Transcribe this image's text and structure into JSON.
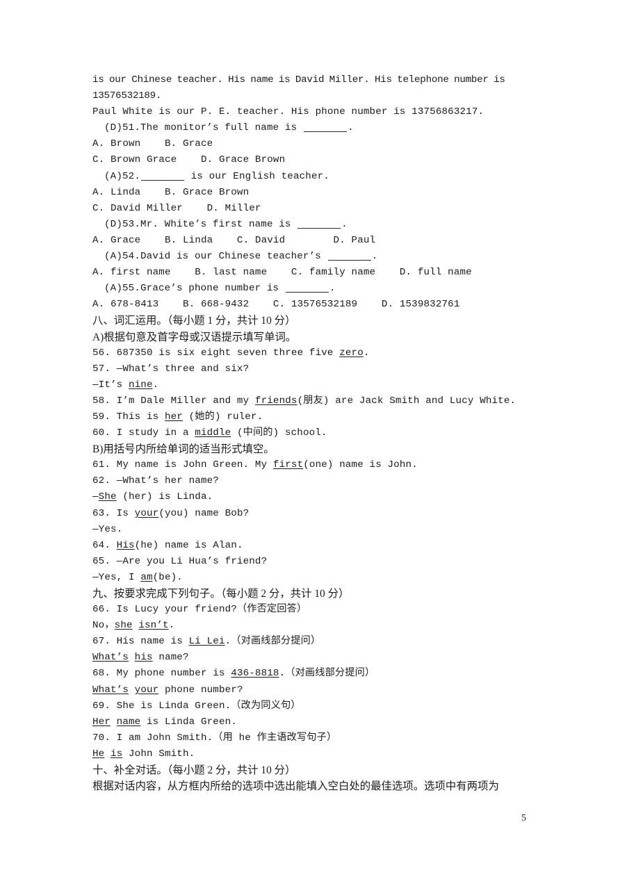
{
  "document": {
    "page_number": "5",
    "lines": [
      {
        "id": "passage-line-1",
        "kind": "en-justified",
        "text": "is our Chinese teacher. His name is David Miller. His telephone number is 13576532189."
      },
      {
        "id": "passage-line-2",
        "kind": "en",
        "text": "Paul White is our P. E. teacher. His phone number is 13756863217."
      },
      {
        "id": "q51-stem",
        "kind": "en-indent-blank",
        "answer": "(D)",
        "number": "51.",
        "text_before": "The monitor’s full name is ",
        "text_after": "."
      },
      {
        "id": "q51-options-1",
        "kind": "en",
        "text": "A. Brown    B. Grace"
      },
      {
        "id": "q51-options-2",
        "kind": "en",
        "text": "C. Brown Grace    D. Grace Brown"
      },
      {
        "id": "q52-stem",
        "kind": "en-indent-blank-lead",
        "answer": "(A)",
        "number": "52.",
        "text_before": "",
        "text_after": " is our English teacher."
      },
      {
        "id": "q52-options-1",
        "kind": "en",
        "text": "A. Linda    B. Grace Brown"
      },
      {
        "id": "q52-options-2",
        "kind": "en",
        "text": "C. David Miller    D. Miller"
      },
      {
        "id": "q53-stem",
        "kind": "en-indent-blank",
        "answer": "(D)",
        "number": "53.",
        "text_before": "Mr. White’s first name is ",
        "text_after": "."
      },
      {
        "id": "q53-options",
        "kind": "en",
        "text": "A. Grace    B. Linda    C. David        D. Paul"
      },
      {
        "id": "q54-stem",
        "kind": "en-indent-blank",
        "answer": "(A)",
        "number": "54.",
        "text_before": "David is our Chinese teacher’s ",
        "text_after": "."
      },
      {
        "id": "q54-options",
        "kind": "en",
        "text": "A. first name    B. last name    C. family name    D. full name"
      },
      {
        "id": "q55-stem",
        "kind": "en-indent-blank",
        "answer": "(A)",
        "number": "55.",
        "text_before": "Grace’s phone number is ",
        "text_after": "."
      },
      {
        "id": "q55-options",
        "kind": "en",
        "text": "A. 678-8413    B. 668-9432    C. 13576532189    D. 1539832761"
      },
      {
        "id": "section-8-heading",
        "kind": "cn",
        "text": "八、词汇运用。（每小题 1 分，共计 10 分）"
      },
      {
        "id": "section-8a-instruction",
        "kind": "cn",
        "text": "A)根据句意及首字母或汉语提示填写单词。"
      },
      {
        "id": "q56",
        "kind": "en-u",
        "parts": [
          {
            "t": "56. 687350 is six eight seven three five "
          },
          {
            "t": "zero",
            "u": true
          },
          {
            "t": "."
          }
        ]
      },
      {
        "id": "q57-line1",
        "kind": "en",
        "text": "57. —What’s three and six?"
      },
      {
        "id": "q57-line2",
        "kind": "en-u",
        "parts": [
          {
            "t": "—It’s "
          },
          {
            "t": "nine",
            "u": true
          },
          {
            "t": "."
          }
        ]
      },
      {
        "id": "q58",
        "kind": "en-u",
        "parts": [
          {
            "t": "58. I’m Dale Miller and my "
          },
          {
            "t": "friends",
            "u": true
          },
          {
            "t": "(朋友) are Jack Smith and Lucy White."
          }
        ]
      },
      {
        "id": "q59",
        "kind": "en-u",
        "parts": [
          {
            "t": "59. This is "
          },
          {
            "t": "her",
            "u": true
          },
          {
            "t": " (她的) ruler."
          }
        ]
      },
      {
        "id": "q60",
        "kind": "en-u",
        "parts": [
          {
            "t": "60. I study in a "
          },
          {
            "t": "middle",
            "u": true
          },
          {
            "t": " (中间的) school."
          }
        ]
      },
      {
        "id": "section-8b-instruction",
        "kind": "cn",
        "text": "B)用括号内所给单词的适当形式填空。"
      },
      {
        "id": "q61",
        "kind": "en-u",
        "parts": [
          {
            "t": "61. My name is John Green. My "
          },
          {
            "t": "first",
            "u": true
          },
          {
            "t": "(one) name is John."
          }
        ]
      },
      {
        "id": "q62-line1",
        "kind": "en",
        "text": "62. —What’s her name?"
      },
      {
        "id": "q62-line2",
        "kind": "en-u",
        "parts": [
          {
            "t": "—"
          },
          {
            "t": "She",
            "u": true
          },
          {
            "t": " (her) is Linda."
          }
        ]
      },
      {
        "id": "q63-line1",
        "kind": "en-u",
        "parts": [
          {
            "t": "63. Is "
          },
          {
            "t": "your",
            "u": true
          },
          {
            "t": "(you) name Bob?"
          }
        ]
      },
      {
        "id": "q63-line2",
        "kind": "en",
        "text": "—Yes."
      },
      {
        "id": "q64",
        "kind": "en-u",
        "parts": [
          {
            "t": "64. "
          },
          {
            "t": "His",
            "u": true
          },
          {
            "t": "(he) name is Alan."
          }
        ]
      },
      {
        "id": "q65-line1",
        "kind": "en",
        "text": "65. —Are you Li Hua’s friend?"
      },
      {
        "id": "q65-line2",
        "kind": "en-u",
        "parts": [
          {
            "t": "—Yes, I "
          },
          {
            "t": "am",
            "u": true
          },
          {
            "t": "(be)."
          }
        ]
      },
      {
        "id": "section-9-heading",
        "kind": "cn",
        "text": "九、按要求完成下列句子。（每小题 2 分，共计 10 分）"
      },
      {
        "id": "q66-line1",
        "kind": "en",
        "text": "66. Is Lucy your friend?（作否定回答）"
      },
      {
        "id": "q66-line2",
        "kind": "en-u",
        "parts": [
          {
            "t": "No，"
          },
          {
            "t": "she",
            "u": true
          },
          {
            "t": " "
          },
          {
            "t": "isn’t",
            "u": true
          },
          {
            "t": "."
          }
        ]
      },
      {
        "id": "q67-line1",
        "kind": "en-u",
        "parts": [
          {
            "t": "67. His name is "
          },
          {
            "t": "Li Lei",
            "u": true
          },
          {
            "t": ".（对画线部分提问）"
          }
        ]
      },
      {
        "id": "q67-line2",
        "kind": "en-u",
        "parts": [
          {
            "t": "What’s",
            "u": true
          },
          {
            "t": " "
          },
          {
            "t": "his",
            "u": true
          },
          {
            "t": " name?"
          }
        ]
      },
      {
        "id": "q68-line1",
        "kind": "en-u",
        "parts": [
          {
            "t": "68. My phone number is "
          },
          {
            "t": "436-8818",
            "u": true
          },
          {
            "t": ".（对画线部分提问）"
          }
        ]
      },
      {
        "id": "q68-line2",
        "kind": "en-u",
        "parts": [
          {
            "t": "What’s",
            "u": true
          },
          {
            "t": " "
          },
          {
            "t": "your",
            "u": true
          },
          {
            "t": " phone number?"
          }
        ]
      },
      {
        "id": "q69-line1",
        "kind": "en",
        "text": "69. She is Linda Green.（改为同义句）"
      },
      {
        "id": "q69-line2",
        "kind": "en-u",
        "parts": [
          {
            "t": "Her",
            "u": true
          },
          {
            "t": " "
          },
          {
            "t": "name",
            "u": true
          },
          {
            "t": " is Linda Green."
          }
        ]
      },
      {
        "id": "q70-line1",
        "kind": "en",
        "text": "70. I am John Smith.（用 he 作主语改写句子）"
      },
      {
        "id": "q70-line2",
        "kind": "en-u",
        "parts": [
          {
            "t": "He",
            "u": true
          },
          {
            "t": " "
          },
          {
            "t": "is",
            "u": true
          },
          {
            "t": " John Smith."
          }
        ]
      },
      {
        "id": "section-10-heading",
        "kind": "cn",
        "text": "十、补全对话。（每小题 2 分，共计 10 分）"
      },
      {
        "id": "section-10-instruction",
        "kind": "cn",
        "text": "根据对话内容，从方框内所给的选项中选出能填入空白处的最佳选项。选项中有两项为"
      }
    ]
  }
}
